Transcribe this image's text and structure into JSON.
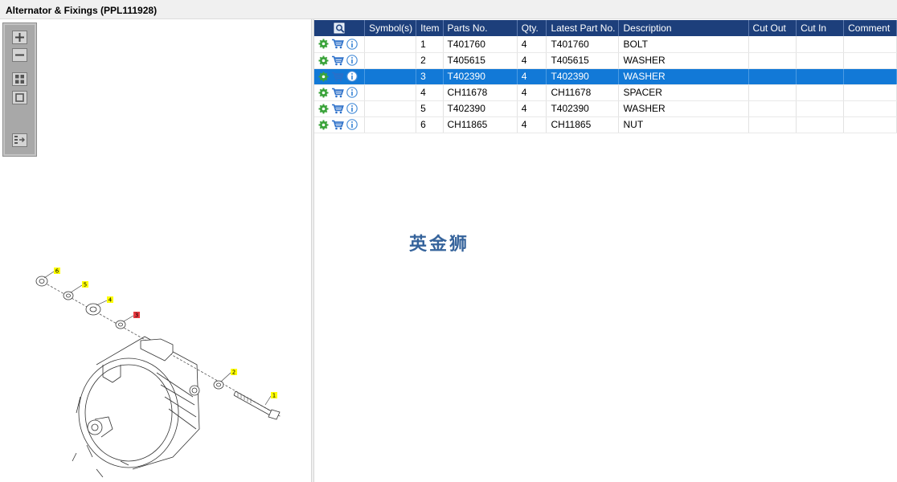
{
  "window": {
    "title": "Alternator & Fixings (PPL111928)"
  },
  "toolbar": {
    "buttons": [
      {
        "name": "zoom-in",
        "icon": "plus-icon"
      },
      {
        "name": "zoom-out",
        "icon": "minus-icon"
      },
      {
        "name": "fit-all",
        "icon": "grid-icon"
      },
      {
        "name": "actual-size",
        "icon": "square-icon"
      },
      {
        "name": "export",
        "icon": "list-arrow-icon"
      }
    ]
  },
  "diagram": {
    "callouts": [
      {
        "label": "1",
        "highlight": false
      },
      {
        "label": "2",
        "highlight": false
      },
      {
        "label": "3",
        "highlight": true
      },
      {
        "label": "4",
        "highlight": false
      },
      {
        "label": "5",
        "highlight": false
      },
      {
        "label": "6",
        "highlight": false
      }
    ]
  },
  "grid": {
    "columns": [
      "",
      "Symbol(s)",
      "Item",
      "Parts No.",
      "Qty.",
      "Latest Part No.",
      "Description",
      "Cut Out",
      "Cut In",
      "Comment"
    ],
    "rows": [
      {
        "item": "1",
        "parts_no": "T401760",
        "qty": "4",
        "latest": "T401760",
        "description": "BOLT",
        "symbols": "",
        "cut_out": "",
        "cut_in": "",
        "comment": ""
      },
      {
        "item": "2",
        "parts_no": "T405615",
        "qty": "4",
        "latest": "T405615",
        "description": "WASHER",
        "symbols": "",
        "cut_out": "",
        "cut_in": "",
        "comment": ""
      },
      {
        "item": "3",
        "parts_no": "T402390",
        "qty": "4",
        "latest": "T402390",
        "description": "WASHER",
        "symbols": "",
        "cut_out": "",
        "cut_in": "",
        "comment": ""
      },
      {
        "item": "4",
        "parts_no": "CH11678",
        "qty": "4",
        "latest": "CH11678",
        "description": "SPACER",
        "symbols": "",
        "cut_out": "",
        "cut_in": "",
        "comment": ""
      },
      {
        "item": "5",
        "parts_no": "T402390",
        "qty": "4",
        "latest": "T402390",
        "description": "WASHER",
        "symbols": "",
        "cut_out": "",
        "cut_in": "",
        "comment": ""
      },
      {
        "item": "6",
        "parts_no": "CH11865",
        "qty": "4",
        "latest": "CH11865",
        "description": "NUT",
        "symbols": "",
        "cut_out": "",
        "cut_in": "",
        "comment": ""
      }
    ],
    "selected_item": "3",
    "row_icons": [
      "gear-icon",
      "cart-icon",
      "info-icon"
    ],
    "header_icon": "magnifier-icon"
  },
  "watermark": "英金狮",
  "colors": {
    "header_bg": "#1d3f7b",
    "selected_row": "#1279d7",
    "callout_yellow": "#ffff00",
    "callout_red": "#e8393f",
    "gear_green": "#3aa33a",
    "cart_blue": "#2a6fc9",
    "info_blue": "#4a8fd8"
  }
}
